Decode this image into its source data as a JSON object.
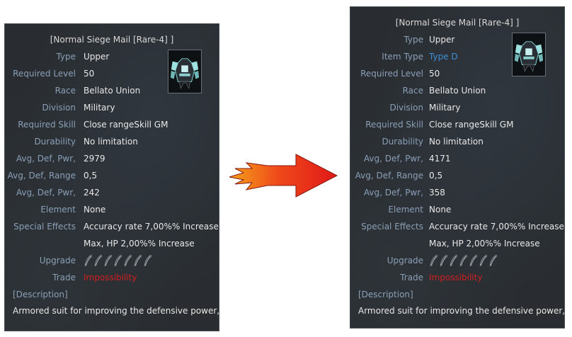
{
  "before": {
    "title": "[Normal Siege Mail [Rare-4] ]",
    "rows": [
      {
        "label": "Type",
        "value": "Upper"
      },
      {
        "label": "Required Level",
        "value": "50"
      },
      {
        "label": "Race",
        "value": "Bellato Union"
      },
      {
        "label": "Division",
        "value": "Military"
      },
      {
        "label": "Required Skill",
        "value": "Close rangeSkill GM"
      },
      {
        "label": "Durability",
        "value": "No limitation"
      },
      {
        "label": "Avg, Def, Pwr,",
        "value": "2979"
      },
      {
        "label": "Avg, Def, Range",
        "value": "0,5"
      },
      {
        "label": "Avg, Def, Pwr,",
        "value": "242"
      },
      {
        "label": "Element",
        "value": "None"
      },
      {
        "label": "Special Effects",
        "value": "Accuracy rate 7,00%% Increase"
      },
      {
        "label": "",
        "value": "Max, HP 2,00%% Increase"
      },
      {
        "label": "Upgrade",
        "value": ""
      },
      {
        "label": "Trade",
        "value": "Impossibility"
      }
    ],
    "description_header": "[Description]",
    "description": "Armored suit for improving the defensive power,"
  },
  "after": {
    "title": "[Normal Siege Mail [Rare-4] ]",
    "rows": [
      {
        "label": "Type",
        "value": "Upper"
      },
      {
        "label": "Item Type",
        "value": "Type D"
      },
      {
        "label": "Required Level",
        "value": "50"
      },
      {
        "label": "Race",
        "value": "Bellato Union"
      },
      {
        "label": "Division",
        "value": "Military"
      },
      {
        "label": "Required Skill",
        "value": "Close rangeSkill GM"
      },
      {
        "label": "Durability",
        "value": "No limitation"
      },
      {
        "label": "Avg, Def, Pwr,",
        "value": "4171"
      },
      {
        "label": "Avg, Def, Range",
        "value": "0,5"
      },
      {
        "label": "Avg, Def, Pwr,",
        "value": "358"
      },
      {
        "label": "Element",
        "value": "None"
      },
      {
        "label": "Special Effects",
        "value": "Accuracy rate 7,00%% Increase"
      },
      {
        "label": "",
        "value": "Max, HP 2,00%% Increase"
      },
      {
        "label": "Upgrade",
        "value": ""
      },
      {
        "label": "Trade",
        "value": "Impossibility"
      }
    ],
    "description_header": "[Description]",
    "description": "Armored suit for improving the defensive power,"
  },
  "icons": {
    "item": "armor-icon",
    "upgrade_slot": "feather-slot-icon",
    "arrow": "arrow-right-icon"
  },
  "colors": {
    "label": "#8a9fb6",
    "value": "#e8e8e8",
    "highlight_blue": "#3f8fd6",
    "trade_red": "#d21e1e",
    "arrow_red": "#e8261b"
  }
}
